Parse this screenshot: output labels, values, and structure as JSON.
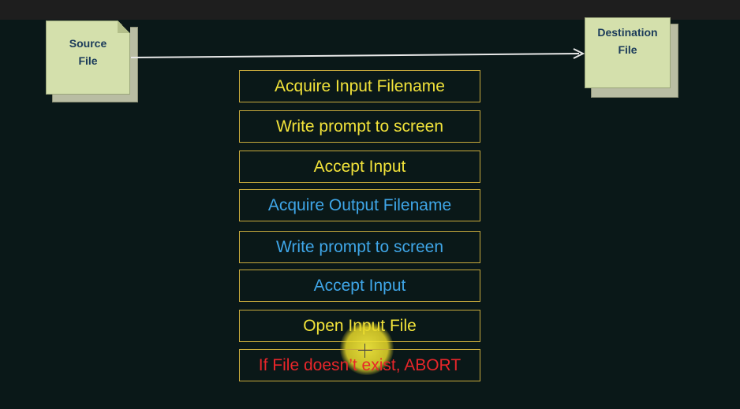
{
  "source_doc": {
    "line1": "Source",
    "line2": "File"
  },
  "dest_doc": {
    "line1": "Destination",
    "line2": "File"
  },
  "steps": [
    {
      "label": "Acquire Input Filename",
      "color": "#f2e33a"
    },
    {
      "label": "Write prompt to screen",
      "color": "#f2e33a"
    },
    {
      "label": "Accept Input",
      "color": "#f2e33a"
    },
    {
      "label": "Acquire Output Filename",
      "color": "#3fa6e8"
    },
    {
      "label": "Write prompt to screen",
      "color": "#3fa6e8"
    },
    {
      "label": "Accept Input",
      "color": "#3fa6e8"
    },
    {
      "label": "Open Input File",
      "color": "#f2e33a"
    },
    {
      "label": "If File doesn’t exist, ABORT",
      "color": "#e8262a"
    }
  ]
}
